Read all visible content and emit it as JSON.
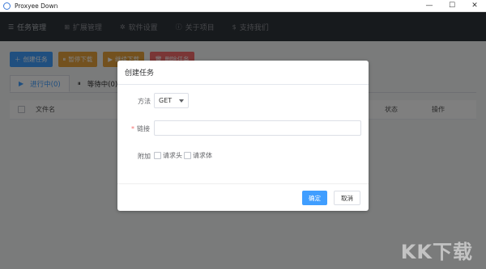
{
  "window": {
    "title": "Proxyee Down",
    "minimize": "—",
    "maximize": "☐",
    "close": "✕"
  },
  "nav": [
    {
      "icon": "☰",
      "label": "任务管理"
    },
    {
      "icon": "⊞",
      "label": "扩展管理"
    },
    {
      "icon": "✲",
      "label": "软件设置"
    },
    {
      "icon": "ⓘ",
      "label": "关于项目"
    },
    {
      "icon": "$",
      "label": "支持我们"
    }
  ],
  "toolbar": {
    "create": "创建任务",
    "pause": "暂停下载",
    "resume": "继续下载",
    "delete": "删除任务"
  },
  "tabs": [
    {
      "icon": "▶",
      "label": "进行中(0)"
    },
    {
      "icon": "⏸",
      "label": "等待中(0)"
    }
  ],
  "table": {
    "headers": {
      "name": "文件名",
      "status": "状态",
      "action": "操作"
    }
  },
  "dialog": {
    "title": "创建任务",
    "method_label": "方法",
    "method_value": "GET",
    "url_label": "链接",
    "url_value": "",
    "extra_label": "附加",
    "opt_headers": "请求头",
    "opt_body": "请求体",
    "confirm": "确定",
    "cancel": "取消"
  },
  "watermark": "KK下载",
  "colors": {
    "primary": "#409eff",
    "warning": "#e6a23c",
    "danger": "#f56c6c",
    "navbar": "#2f343b"
  }
}
